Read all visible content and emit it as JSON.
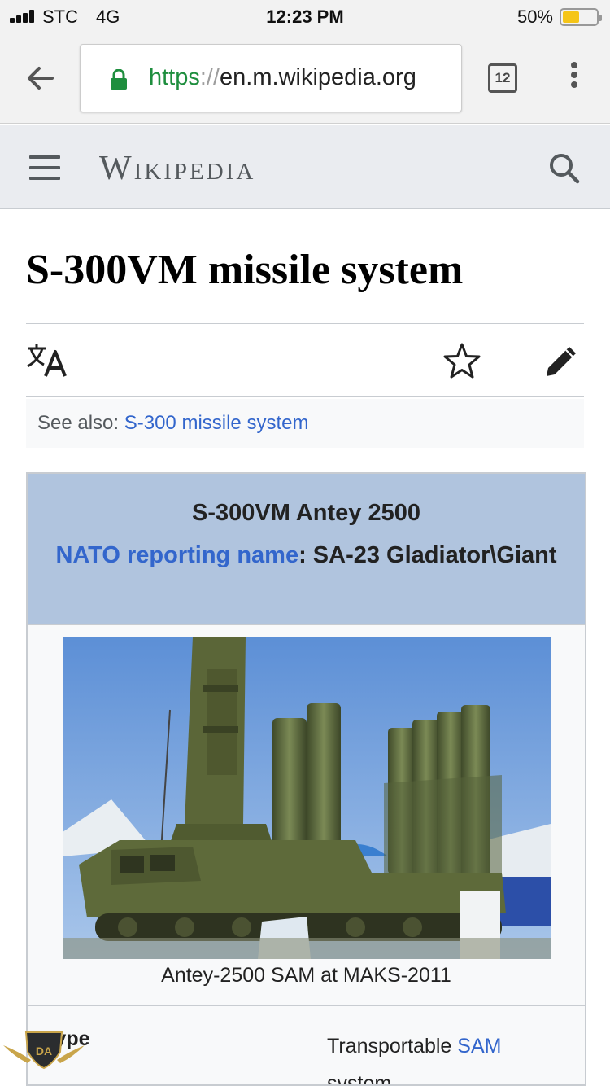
{
  "status_bar": {
    "carrier": "STC",
    "network": "4G",
    "time": "12:23 PM",
    "battery_percent": "50%",
    "battery_level": 0.5
  },
  "browser": {
    "url_scheme": "https",
    "url_separator": "://",
    "url_host": "en.m.wikipedia.org",
    "tab_count": "12",
    "icons": [
      "back-arrow-icon",
      "lock-icon",
      "tabs-icon",
      "more-vert-icon"
    ]
  },
  "wiki": {
    "wordmark": "Wikipedia",
    "icons": [
      "menu-icon",
      "search-icon"
    ]
  },
  "article": {
    "title": "S-300VM missile system",
    "actions": [
      "language-icon",
      "watch-star-icon",
      "edit-pencil-icon"
    ],
    "hatnote_prefix": "See also: ",
    "hatnote_link": "S-300 missile system"
  },
  "infobox": {
    "name": "S-300VM Antey 2500",
    "nato_link": "NATO reporting name",
    "nato_sep": ": ",
    "nato_value": "SA-23 Gladiator\\Giant",
    "caption": "Antey-2500 SAM at MAKS-2011",
    "type_label": "Type",
    "type_value_prefix": "Transportable ",
    "type_value_link": "SAM",
    "type_value_suffix": "system"
  },
  "colors": {
    "link": "#3366cc",
    "infobox_header": "#b0c4de",
    "url_green": "#1e8e3e",
    "battery": "#f5c518"
  }
}
